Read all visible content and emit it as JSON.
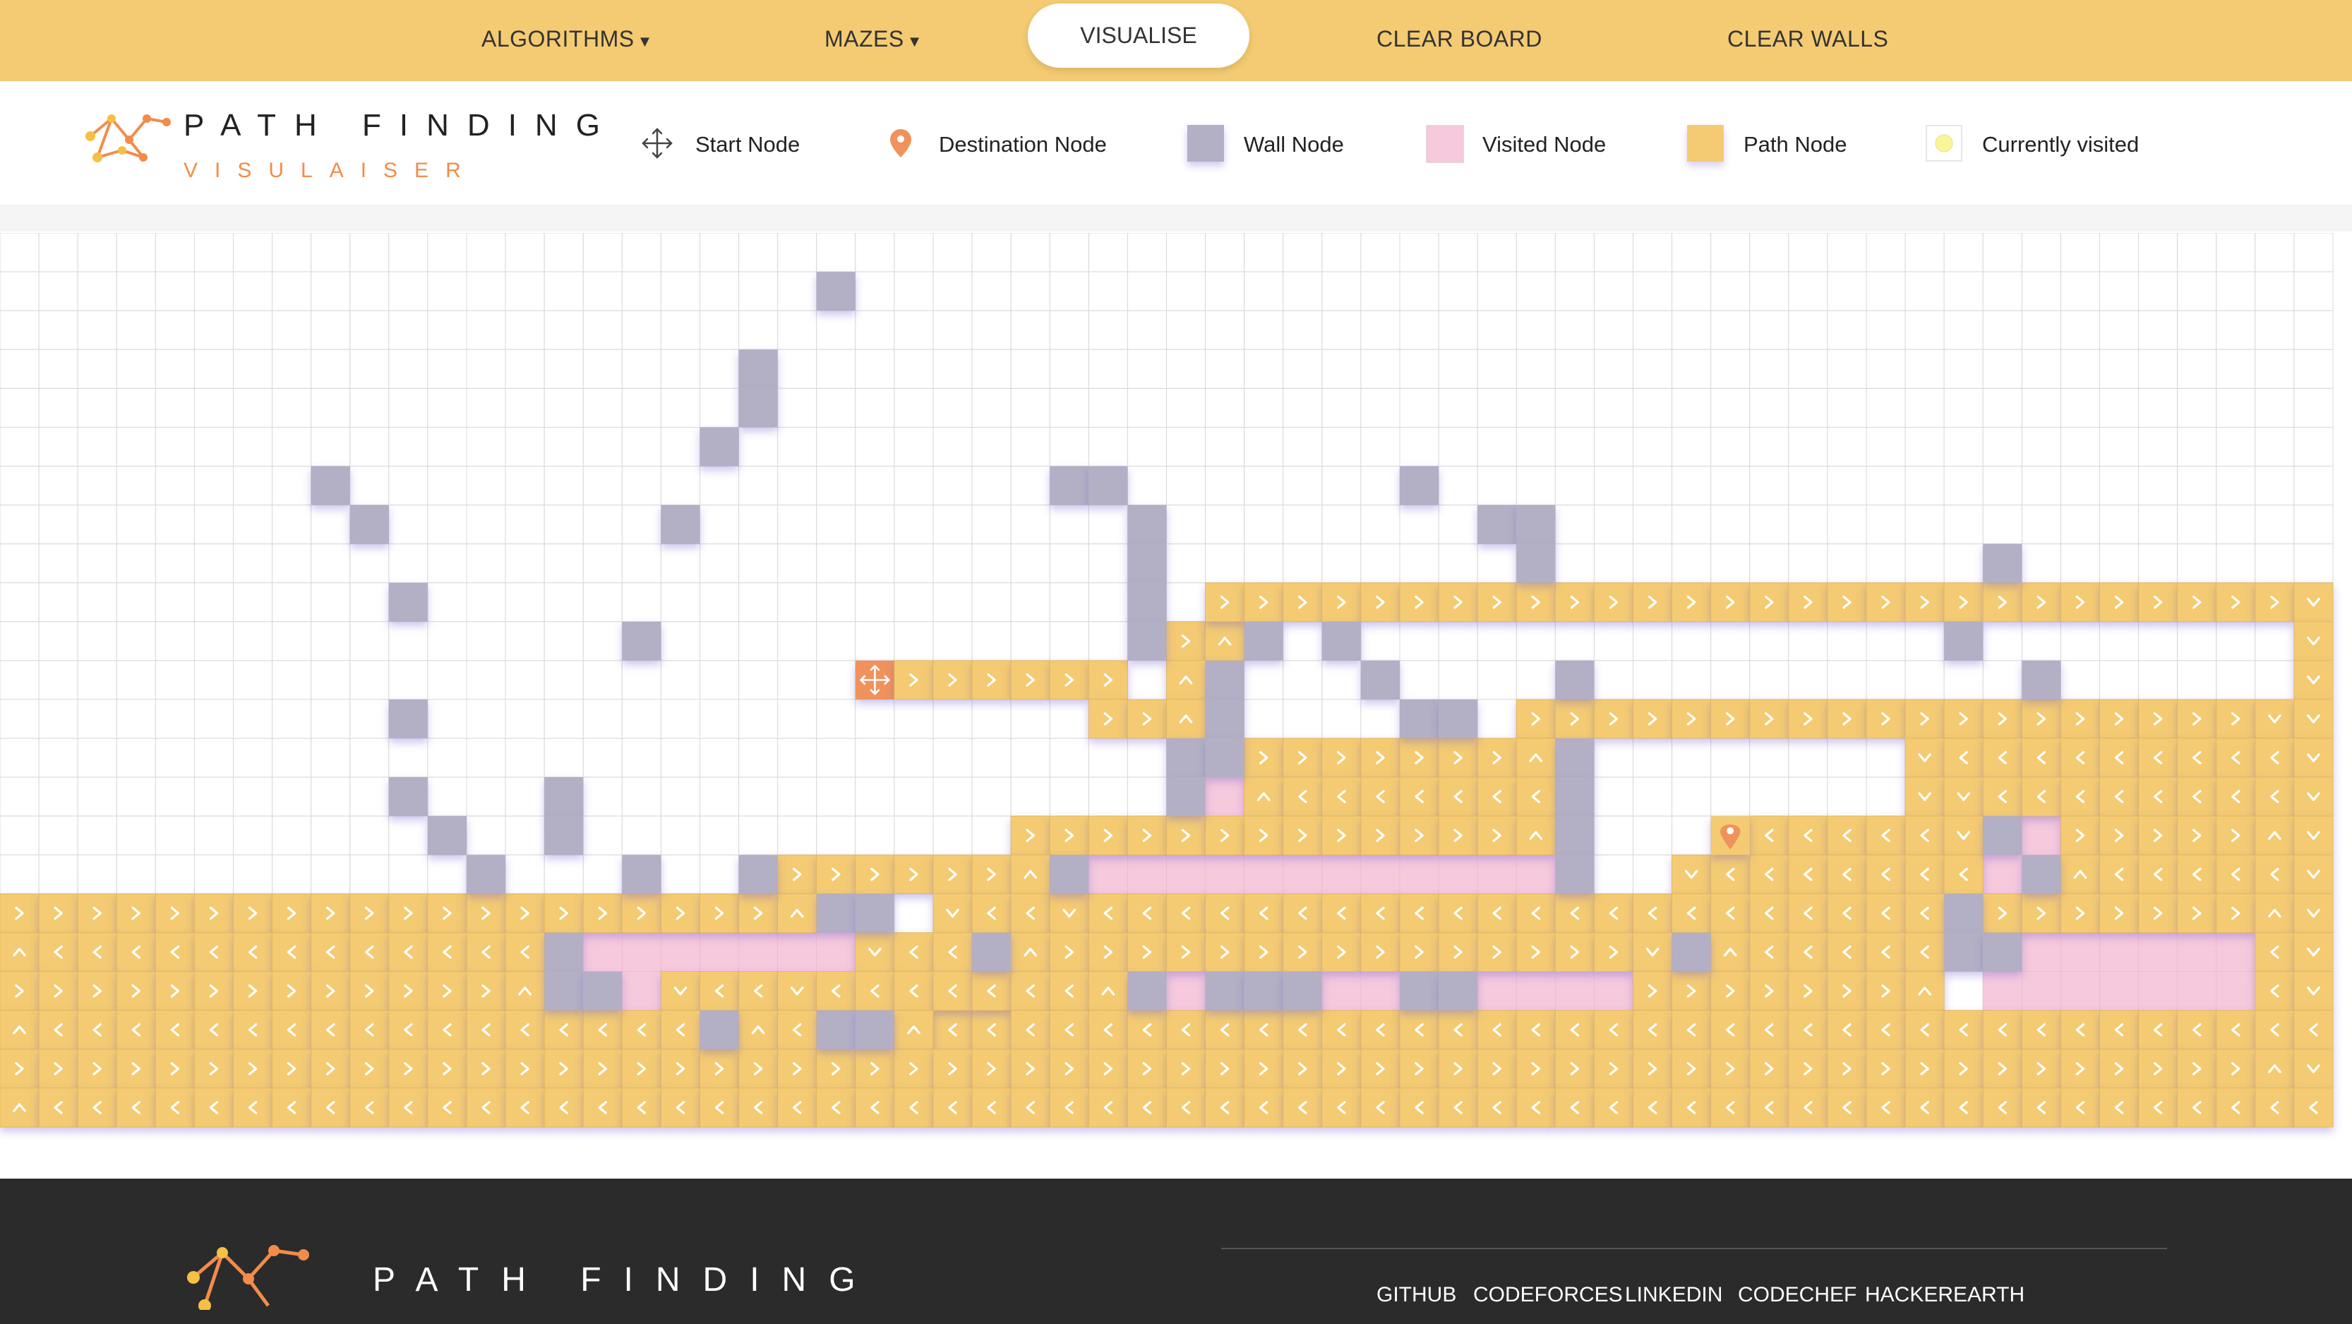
{
  "nav": {
    "algorithms": "ALGORITHMS",
    "mazes": "MAZES",
    "visualise": "VISUALISE",
    "clear_board": "CLEAR BOARD",
    "clear_walls": "CLEAR WALLS"
  },
  "logo": {
    "title": "PATH FINDING",
    "subtitle": "VISULAISER"
  },
  "legend": {
    "start": "Start Node",
    "destination": "Destination Node",
    "wall": "Wall Node",
    "visited": "Visited Node",
    "path": "Path Node",
    "current": "Currently visited"
  },
  "colors": {
    "nav": "#f4cb72",
    "path": "#f4cb72",
    "wall": "#b3afc4",
    "visited": "#f6c9dc",
    "start": "#f0925c",
    "destination_icon": "#f0925c",
    "current": "#fbf59a",
    "grid_line": "#d8d8d8",
    "footer": "#2b2b2b"
  },
  "grid": {
    "columns": 60,
    "rows": 23,
    "start": {
      "row": 11,
      "col": 22
    },
    "destination": {
      "row": 15,
      "col": 44
    },
    "walls": [
      [
        1,
        21
      ],
      [
        3,
        19
      ],
      [
        4,
        19
      ],
      [
        5,
        18
      ],
      [
        6,
        8
      ],
      [
        6,
        27
      ],
      [
        6,
        28
      ],
      [
        6,
        36
      ],
      [
        7,
        9
      ],
      [
        7,
        17
      ],
      [
        7,
        29
      ],
      [
        7,
        38
      ],
      [
        7,
        39
      ],
      [
        8,
        29
      ],
      [
        8,
        39
      ],
      [
        8,
        51
      ],
      [
        9,
        10
      ],
      [
        9,
        29
      ],
      [
        10,
        16
      ],
      [
        10,
        29
      ],
      [
        10,
        32
      ],
      [
        10,
        34
      ],
      [
        10,
        50
      ],
      [
        11,
        31
      ],
      [
        11,
        35
      ],
      [
        11,
        40
      ],
      [
        11,
        52
      ],
      [
        12,
        10
      ],
      [
        12,
        31
      ],
      [
        12,
        36
      ],
      [
        12,
        37
      ],
      [
        13,
        30
      ],
      [
        13,
        31
      ],
      [
        13,
        40
      ],
      [
        14,
        10
      ],
      [
        14,
        14
      ],
      [
        14,
        30
      ],
      [
        14,
        40
      ],
      [
        15,
        11
      ],
      [
        15,
        14
      ],
      [
        15,
        40
      ],
      [
        15,
        51
      ],
      [
        16,
        12
      ],
      [
        16,
        16
      ],
      [
        16,
        19
      ],
      [
        16,
        27
      ],
      [
        16,
        40
      ],
      [
        16,
        52
      ],
      [
        17,
        21
      ],
      [
        17,
        22
      ],
      [
        17,
        50
      ],
      [
        18,
        14
      ],
      [
        18,
        25
      ],
      [
        18,
        43
      ],
      [
        18,
        50
      ],
      [
        18,
        51
      ],
      [
        19,
        14
      ],
      [
        19,
        15
      ],
      [
        19,
        29
      ],
      [
        19,
        31
      ],
      [
        19,
        32
      ],
      [
        19,
        33
      ],
      [
        19,
        36
      ],
      [
        19,
        37
      ],
      [
        20,
        18
      ],
      [
        20,
        21
      ],
      [
        20,
        22
      ]
    ],
    "visited": [
      [
        14,
        31
      ],
      [
        15,
        52
      ],
      [
        16,
        28
      ],
      [
        16,
        29
      ],
      [
        16,
        30
      ],
      [
        16,
        31
      ],
      [
        16,
        32
      ],
      [
        16,
        33
      ],
      [
        16,
        34
      ],
      [
        16,
        35
      ],
      [
        16,
        36
      ],
      [
        16,
        37
      ],
      [
        16,
        38
      ],
      [
        16,
        39
      ],
      [
        16,
        51
      ],
      [
        18,
        15
      ],
      [
        18,
        16
      ],
      [
        18,
        17
      ],
      [
        18,
        18
      ],
      [
        18,
        19
      ],
      [
        18,
        20
      ],
      [
        18,
        21
      ],
      [
        18,
        52
      ],
      [
        18,
        53
      ],
      [
        18,
        54
      ],
      [
        18,
        55
      ],
      [
        18,
        56
      ],
      [
        18,
        57
      ],
      [
        19,
        16
      ],
      [
        19,
        51
      ],
      [
        19,
        52
      ],
      [
        19,
        53
      ],
      [
        19,
        54
      ],
      [
        19,
        55
      ],
      [
        19,
        56
      ],
      [
        19,
        57
      ],
      [
        19,
        30
      ],
      [
        19,
        34
      ],
      [
        19,
        35
      ],
      [
        19,
        38
      ],
      [
        19,
        39
      ],
      [
        19,
        40
      ],
      [
        19,
        41
      ],
      [
        20,
        24
      ],
      [
        20,
        25
      ]
    ],
    "path": [
      {
        "row": 11,
        "c1": 22,
        "c2": 28,
        "dir": ">"
      },
      {
        "row": 10,
        "c1": 30,
        "c2": 30,
        "dir": ">"
      },
      {
        "row": 10,
        "c1": 31,
        "c2": 31,
        "dir": "^"
      },
      {
        "row": 9,
        "c1": 31,
        "c2": 58,
        "dir": ">"
      },
      {
        "row": 9,
        "c1": 59,
        "c2": 59,
        "dir": "v"
      },
      {
        "row": 10,
        "c1": 59,
        "c2": 59,
        "dir": "v"
      },
      {
        "row": 11,
        "c1": 59,
        "c2": 59,
        "dir": "v"
      },
      {
        "row": 11,
        "c1": 30,
        "c2": 30,
        "dir": "^"
      },
      {
        "row": 12,
        "c1": 28,
        "c2": 29,
        "dir": ">"
      },
      {
        "row": 12,
        "c1": 30,
        "c2": 30,
        "dir": "^"
      },
      {
        "row": 12,
        "c1": 39,
        "c2": 57,
        "dir": ">"
      },
      {
        "row": 12,
        "c1": 58,
        "c2": 59,
        "dir": "v"
      },
      {
        "row": 13,
        "c1": 32,
        "c2": 38,
        "dir": ">"
      },
      {
        "row": 13,
        "c1": 39,
        "c2": 39,
        "dir": "^"
      },
      {
        "row": 13,
        "c1": 49,
        "c2": 49,
        "dir": "v"
      },
      {
        "row": 13,
        "c1": 50,
        "c2": 58,
        "dir": "<"
      },
      {
        "row": 13,
        "c1": 59,
        "c2": 59,
        "dir": "v"
      },
      {
        "row": 14,
        "c1": 32,
        "c2": 32,
        "dir": "^"
      },
      {
        "row": 14,
        "c1": 33,
        "c2": 39,
        "dir": "<"
      },
      {
        "row": 14,
        "c1": 49,
        "c2": 49,
        "dir": "v"
      },
      {
        "row": 14,
        "c1": 50,
        "c2": 50,
        "dir": "v"
      },
      {
        "row": 14,
        "c1": 51,
        "c2": 58,
        "dir": "<"
      },
      {
        "row": 14,
        "c1": 59,
        "c2": 59,
        "dir": "v"
      },
      {
        "row": 15,
        "c1": 26,
        "c2": 38,
        "dir": ">"
      },
      {
        "row": 15,
        "c1": 39,
        "c2": 39,
        "dir": "^"
      },
      {
        "row": 15,
        "c1": 45,
        "c2": 49,
        "dir": "<"
      },
      {
        "row": 15,
        "c1": 50,
        "c2": 50,
        "dir": "v"
      },
      {
        "row": 15,
        "c1": 53,
        "c2": 57,
        "dir": ">"
      },
      {
        "row": 15,
        "c1": 58,
        "c2": 58,
        "dir": "^"
      },
      {
        "row": 15,
        "c1": 59,
        "c2": 59,
        "dir": "v"
      },
      {
        "row": 16,
        "c1": 20,
        "c2": 25,
        "dir": ">"
      },
      {
        "row": 16,
        "c1": 26,
        "c2": 26,
        "dir": "^"
      },
      {
        "row": 16,
        "c1": 43,
        "c2": 43,
        "dir": "v"
      },
      {
        "row": 16,
        "c1": 44,
        "c2": 50,
        "dir": "<"
      },
      {
        "row": 16,
        "c1": 53,
        "c2": 53,
        "dir": "^"
      },
      {
        "row": 16,
        "c1": 54,
        "c2": 58,
        "dir": "<"
      },
      {
        "row": 16,
        "c1": 59,
        "c2": 59,
        "dir": "v"
      },
      {
        "row": 17,
        "c1": 0,
        "c2": 19,
        "dir": ">"
      },
      {
        "row": 17,
        "c1": 20,
        "c2": 20,
        "dir": "^"
      },
      {
        "row": 17,
        "c1": 24,
        "c2": 24,
        "dir": "v"
      },
      {
        "row": 17,
        "c1": 25,
        "c2": 26,
        "dir": "<"
      },
      {
        "row": 17,
        "c1": 27,
        "c2": 27,
        "dir": "v"
      },
      {
        "row": 17,
        "c1": 28,
        "c2": 49,
        "dir": "<"
      },
      {
        "row": 17,
        "c1": 51,
        "c2": 57,
        "dir": ">"
      },
      {
        "row": 17,
        "c1": 58,
        "c2": 58,
        "dir": "^"
      },
      {
        "row": 17,
        "c1": 59,
        "c2": 59,
        "dir": "v"
      },
      {
        "row": 18,
        "c1": 0,
        "c2": 0,
        "dir": "^"
      },
      {
        "row": 18,
        "c1": 1,
        "c2": 13,
        "dir": "<"
      },
      {
        "row": 18,
        "c1": 22,
        "c2": 22,
        "dir": "v"
      },
      {
        "row": 18,
        "c1": 23,
        "c2": 24,
        "dir": "<"
      },
      {
        "row": 18,
        "c1": 26,
        "c2": 26,
        "dir": "^"
      },
      {
        "row": 18,
        "c1": 27,
        "c2": 41,
        "dir": ">"
      },
      {
        "row": 18,
        "c1": 42,
        "c2": 42,
        "dir": "v"
      },
      {
        "row": 18,
        "c1": 44,
        "c2": 44,
        "dir": "^"
      },
      {
        "row": 18,
        "c1": 45,
        "c2": 49,
        "dir": "<"
      },
      {
        "row": 18,
        "c1": 58,
        "c2": 58,
        "dir": "<"
      },
      {
        "row": 18,
        "c1": 59,
        "c2": 59,
        "dir": "v"
      },
      {
        "row": 19,
        "c1": 0,
        "c2": 12,
        "dir": ">"
      },
      {
        "row": 19,
        "c1": 13,
        "c2": 13,
        "dir": "^"
      },
      {
        "row": 19,
        "c1": 17,
        "c2": 17,
        "dir": "v"
      },
      {
        "row": 19,
        "c1": 18,
        "c2": 19,
        "dir": "<"
      },
      {
        "row": 19,
        "c1": 20,
        "c2": 20,
        "dir": "v"
      },
      {
        "row": 19,
        "c1": 21,
        "c2": 27,
        "dir": "<"
      },
      {
        "row": 19,
        "c1": 28,
        "c2": 28,
        "dir": "^"
      },
      {
        "row": 19,
        "c1": 42,
        "c2": 48,
        "dir": ">"
      },
      {
        "row": 19,
        "c1": 49,
        "c2": 49,
        "dir": "^"
      },
      {
        "row": 19,
        "c1": 58,
        "c2": 58,
        "dir": "<"
      },
      {
        "row": 19,
        "c1": 59,
        "c2": 59,
        "dir": "v"
      },
      {
        "row": 20,
        "c1": 0,
        "c2": 0,
        "dir": "^"
      },
      {
        "row": 20,
        "c1": 1,
        "c2": 17,
        "dir": "<"
      },
      {
        "row": 20,
        "c1": 19,
        "c2": 19,
        "dir": "^"
      },
      {
        "row": 20,
        "c1": 20,
        "c2": 20,
        "dir": "<"
      },
      {
        "row": 20,
        "c1": 23,
        "c2": 23,
        "dir": "^"
      },
      {
        "row": 20,
        "c1": 24,
        "c2": 59,
        "dir": "<"
      },
      {
        "row": 21,
        "c1": 0,
        "c2": 57,
        "dir": ">"
      },
      {
        "row": 21,
        "c1": 58,
        "c2": 58,
        "dir": "^"
      },
      {
        "row": 21,
        "c1": 59,
        "c2": 59,
        "dir": "v"
      },
      {
        "row": 22,
        "c1": 0,
        "c2": 0,
        "dir": "^"
      },
      {
        "row": 22,
        "c1": 1,
        "c2": 59,
        "dir": "<"
      }
    ]
  },
  "footer": {
    "title": "PATH FINDING",
    "links": [
      "GITHUB",
      "CODEFORCES",
      "LINKEDIN",
      "CODECHEF",
      "HACKEREARTH"
    ]
  }
}
